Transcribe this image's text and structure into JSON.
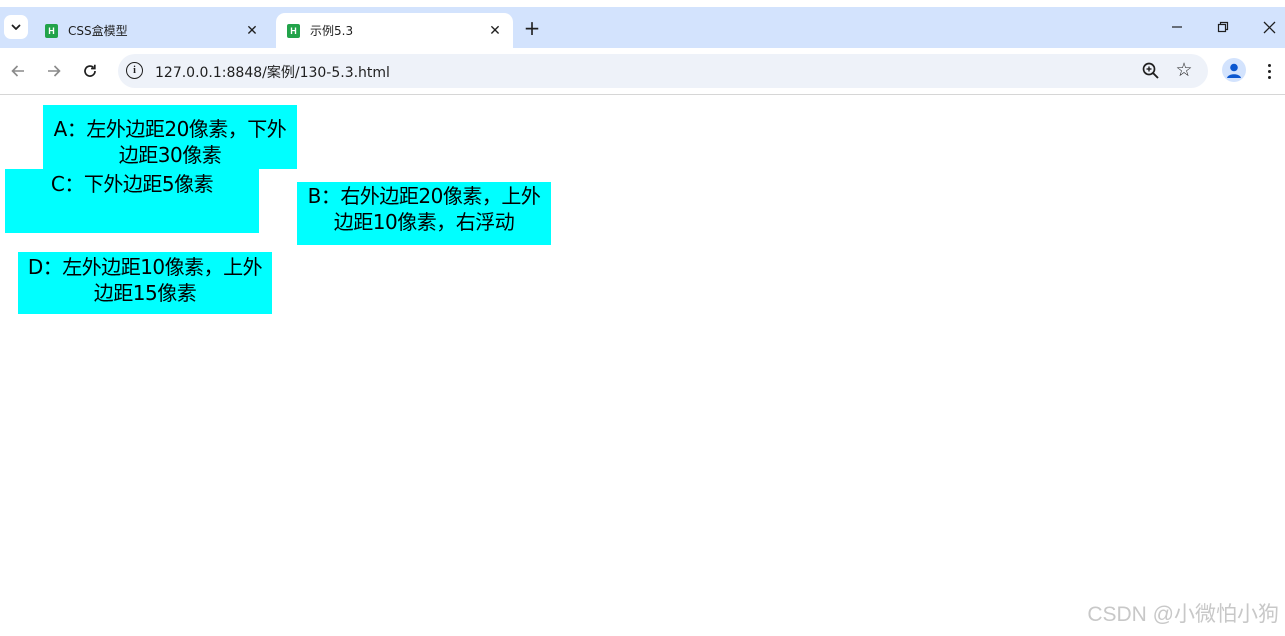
{
  "browser": {
    "tabs": [
      {
        "title": "CSS盒模型",
        "active": false
      },
      {
        "title": "示例5.3",
        "active": true
      }
    ],
    "address": "127.0.0.1:8848/案例/130-5.3.html",
    "icons": {
      "tab_search": "chevron-down-icon",
      "favicon": "hbuilder-icon",
      "new_tab": "plus-icon",
      "minimize": "minimize-icon",
      "restore": "restore-icon",
      "close": "close-icon",
      "back": "back-arrow-icon",
      "forward": "forward-arrow-icon",
      "reload": "reload-icon",
      "site_info": "info-icon",
      "zoom": "zoom-icon",
      "bookmark": "star-icon",
      "profile": "profile-icon",
      "menu": "more-vert-icon"
    },
    "favicon_letter": "H"
  },
  "page": {
    "background": "#ffffff",
    "box_color": "#00ffff",
    "boxes": {
      "a": [
        "A：左外边距20像素，下外",
        "边距30像素"
      ],
      "c": [
        "C：下外边距5像素"
      ],
      "b": [
        "B：右外边距20像素，上外",
        "边距10像素，右浮动"
      ],
      "d": [
        "D：左外边距10像素，上外",
        "边距15像素"
      ]
    }
  },
  "watermark": "CSDN @小微怕小狗"
}
